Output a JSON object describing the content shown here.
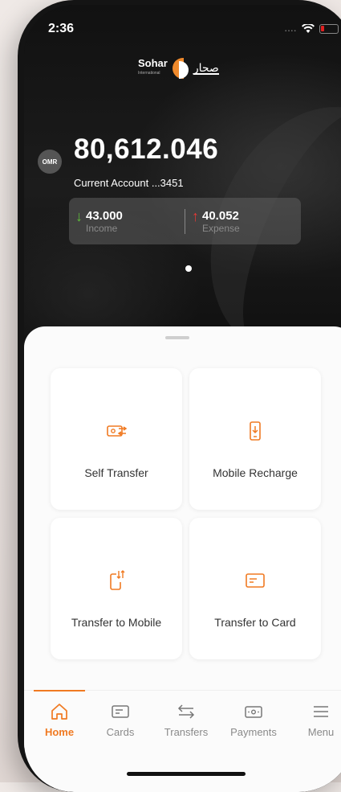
{
  "status": {
    "time": "2:36",
    "signal": "...."
  },
  "brand": {
    "name_en": "Sohar",
    "name_sub": "International",
    "name_ar": "صحار"
  },
  "account": {
    "currency": "OMR",
    "balance": "80,612.046",
    "label": "Current Account ...3451",
    "income_value": "43.000",
    "income_label": "Income",
    "expense_value": "40.052",
    "expense_label": "Expense"
  },
  "actions": [
    {
      "label": "Self Transfer",
      "icon": "self-transfer-icon"
    },
    {
      "label": "Mobile Recharge",
      "icon": "mobile-recharge-icon"
    },
    {
      "label": "Transfer to Mobile",
      "icon": "transfer-mobile-icon"
    },
    {
      "label": "Transfer to Card",
      "icon": "card-icon"
    }
  ],
  "tabs": [
    {
      "label": "Home",
      "icon": "home-icon",
      "active": true
    },
    {
      "label": "Cards",
      "icon": "cards-icon"
    },
    {
      "label": "Transfers",
      "icon": "transfers-icon"
    },
    {
      "label": "Payments",
      "icon": "payments-icon"
    },
    {
      "label": "Menu",
      "icon": "menu-icon"
    }
  ],
  "colors": {
    "accent": "#f07a22",
    "income": "#5fbf3a",
    "expense": "#e53935"
  }
}
